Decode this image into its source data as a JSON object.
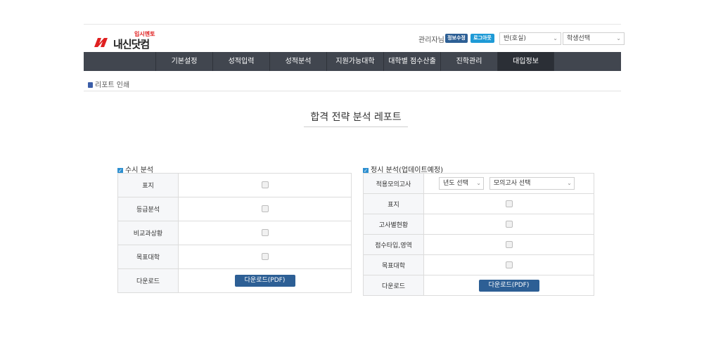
{
  "header": {
    "brand_slogan": "입시멘토",
    "brand_name": "내신닷컴",
    "admin_label": "관리자님",
    "edit_info_label": "정보수정",
    "logout_label": "로그아웃",
    "class_select": "반(호실)",
    "student_select": "학생선택"
  },
  "nav": {
    "items": [
      "기본설정",
      "성적입력",
      "성적분석",
      "지원가능대학",
      "대학별 점수산출",
      "진학관리",
      "대입정보"
    ],
    "active_index": 6
  },
  "breadcrumb": {
    "label": "리포트 인쇄"
  },
  "page": {
    "title": "합격 전략 분석 레포트"
  },
  "susi": {
    "title": "수시 분석",
    "rows": [
      {
        "label": "표지"
      },
      {
        "label": "등급분석"
      },
      {
        "label": "비교과상황"
      },
      {
        "label": "목표대학"
      }
    ],
    "download_label": "다운로드",
    "download_button": "다운로드(PDF)"
  },
  "jeongsi": {
    "title": "정시 분석(업데이트예정)",
    "mock_exam_label": "적용모의고사",
    "year_select": "년도 선택",
    "exam_select": "모의고사 선택",
    "rows": [
      {
        "label": "표지"
      },
      {
        "label": "고사별현황"
      },
      {
        "label": "점수타입,영역"
      },
      {
        "label": "목표대학"
      }
    ],
    "download_label": "다운로드",
    "download_button": "다운로드(PDF)"
  },
  "colors": {
    "nav_bg": "#41464f",
    "primary": "#2d5f95",
    "accent": "#1e9ad6",
    "brand_red": "#e02020"
  }
}
